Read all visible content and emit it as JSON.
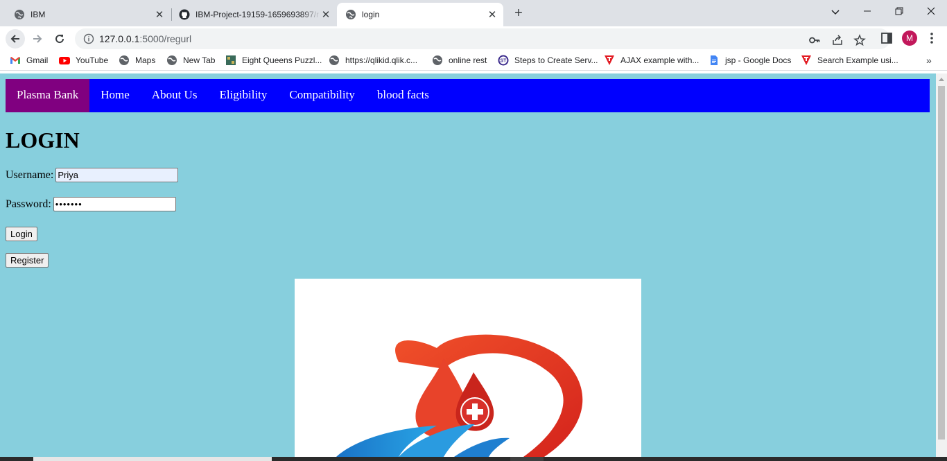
{
  "browser": {
    "tabs": [
      {
        "title": "IBM",
        "active": false,
        "icon": "globe-icon"
      },
      {
        "title": "IBM-Project-19159-1659693897/r",
        "active": false,
        "icon": "github-icon"
      },
      {
        "title": "login",
        "active": true,
        "icon": "globe-icon"
      }
    ],
    "url": {
      "host": "127.0.0.1",
      "rest": ":5000/regurl"
    },
    "profile_initial": "M",
    "bookmarks": [
      {
        "label": "Gmail",
        "icon": "gmail-icon"
      },
      {
        "label": "YouTube",
        "icon": "youtube-icon"
      },
      {
        "label": "Maps",
        "icon": "globe-icon"
      },
      {
        "label": "New Tab",
        "icon": "globe-icon"
      },
      {
        "label": "Eight Queens Puzzl...",
        "icon": "image-icon"
      },
      {
        "label": "https://qlikid.qlik.c...",
        "icon": "globe-icon"
      },
      {
        "label": "online rest",
        "icon": "globe-icon"
      },
      {
        "label": "Steps to Create Serv...",
        "icon": "st-icon"
      },
      {
        "label": "AJAX example with...",
        "icon": "tutorialspoint-icon"
      },
      {
        "label": "jsp - Google Docs",
        "icon": "google-docs-icon"
      },
      {
        "label": "Search Example usi...",
        "icon": "tutorialspoint-icon"
      }
    ]
  },
  "site": {
    "nav": [
      "Plasma Bank",
      "Home",
      "About Us",
      "Eligibility",
      "Compatibility",
      "blood facts"
    ],
    "title": "LOGIN",
    "username_label": "Username:",
    "username_value": "Priya",
    "password_label": "Password:",
    "password_value": "•••••••",
    "login_button": "Login",
    "register_button": "Register"
  },
  "colors": {
    "nav_bg": "#0000ff",
    "brand_bg": "#800080",
    "page_bg": "#87cfdd"
  }
}
